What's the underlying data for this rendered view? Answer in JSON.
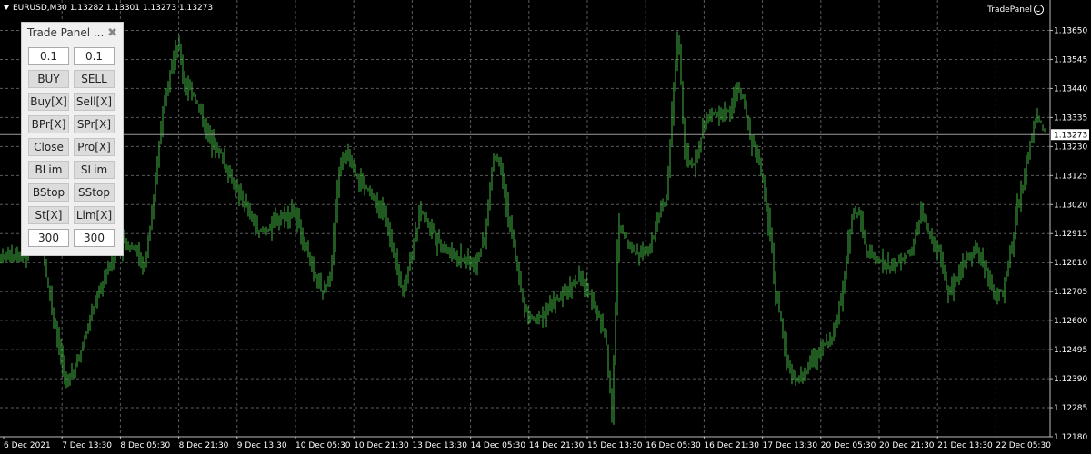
{
  "header": {
    "symbol_line": "EURUSD,M30  1.13282 1.13301 1.13273 1.13273",
    "expert_label": "TradePanel"
  },
  "price_axis": {
    "labels": [
      "1.13650",
      "1.13545",
      "1.13440",
      "1.13335",
      "1.13230",
      "1.13125",
      "1.13020",
      "1.12915",
      "1.12810",
      "1.12705",
      "1.12600",
      "1.12495",
      "1.12390",
      "1.12285",
      "1.12180"
    ],
    "current_price": "1.13273"
  },
  "time_axis": {
    "labels": [
      "6 Dec 2021",
      "7 Dec 13:30",
      "8 Dec 05:30",
      "8 Dec 21:30",
      "9 Dec 13:30",
      "10 Dec 05:30",
      "10 Dec 21:30",
      "13 Dec 13:30",
      "14 Dec 05:30",
      "14 Dec 21:30",
      "15 Dec 13:30",
      "16 Dec 05:30",
      "16 Dec 21:30",
      "17 Dec 13:30",
      "20 Dec 05:30",
      "20 Dec 21:30",
      "21 Dec 13:30",
      "22 Dec 05:30"
    ]
  },
  "colors": {
    "background": "#000000",
    "grid": "#5a5a5a",
    "bars": "#3fb53f",
    "text": "#ffffff"
  },
  "panel": {
    "title": "Trade Panel ...",
    "close_icon": "close-icon",
    "rows": [
      [
        {
          "type": "input",
          "label": "0.1",
          "name": "buy-lot-input"
        },
        {
          "type": "input",
          "label": "0.1",
          "name": "sell-lot-input"
        }
      ],
      [
        {
          "type": "button",
          "label": "BUY",
          "name": "buy-button"
        },
        {
          "type": "button",
          "label": "SELL",
          "name": "sell-button"
        }
      ],
      [
        {
          "type": "button",
          "label": "Buy[X]",
          "name": "close-buy-button"
        },
        {
          "type": "button",
          "label": "Sell[X]",
          "name": "close-sell-button"
        }
      ],
      [
        {
          "type": "button",
          "label": "BPr[X]",
          "name": "close-buy-profit-button"
        },
        {
          "type": "button",
          "label": "SPr[X]",
          "name": "close-sell-profit-button"
        }
      ],
      [
        {
          "type": "button",
          "label": "Close",
          "name": "close-all-button"
        },
        {
          "type": "button",
          "label": "Pro[X]",
          "name": "close-profit-button"
        }
      ],
      [
        {
          "type": "button",
          "label": "BLim",
          "name": "buy-limit-button"
        },
        {
          "type": "button",
          "label": "SLim",
          "name": "sell-limit-button"
        }
      ],
      [
        {
          "type": "button",
          "label": "BStop",
          "name": "buy-stop-button"
        },
        {
          "type": "button",
          "label": "SStop",
          "name": "sell-stop-button"
        }
      ],
      [
        {
          "type": "button",
          "label": "St[X]",
          "name": "delete-stops-button"
        },
        {
          "type": "button",
          "label": "Lim[X]",
          "name": "delete-limits-button"
        }
      ],
      [
        {
          "type": "input",
          "label": "300",
          "name": "buy-distance-input"
        },
        {
          "type": "input",
          "label": "300",
          "name": "sell-distance-input"
        }
      ]
    ]
  },
  "chart_data": {
    "type": "ohlc",
    "symbol": "EURUSD",
    "timeframe": "M30",
    "ylim": [
      1.1218,
      1.1376
    ],
    "last_price": 1.13273,
    "grid": true,
    "price_path": [
      [
        0,
        1.1283
      ],
      [
        30,
        1.1284
      ],
      [
        45,
        1.1292
      ],
      [
        60,
        1.1263
      ],
      [
        75,
        1.1237
      ],
      [
        90,
        1.1248
      ],
      [
        105,
        1.1265
      ],
      [
        120,
        1.1278
      ],
      [
        135,
        1.1288
      ],
      [
        150,
        1.1287
      ],
      [
        160,
        1.1278
      ],
      [
        170,
        1.13
      ],
      [
        180,
        1.1335
      ],
      [
        190,
        1.1352
      ],
      [
        198,
        1.136
      ],
      [
        205,
        1.1345
      ],
      [
        215,
        1.1342
      ],
      [
        230,
        1.1328
      ],
      [
        245,
        1.132
      ],
      [
        260,
        1.1308
      ],
      [
        275,
        1.13
      ],
      [
        285,
        1.1292
      ],
      [
        295,
        1.1293
      ],
      [
        310,
        1.1297
      ],
      [
        325,
        1.13
      ],
      [
        335,
        1.129
      ],
      [
        345,
        1.128
      ],
      [
        355,
        1.127
      ],
      [
        365,
        1.1275
      ],
      [
        375,
        1.1315
      ],
      [
        385,
        1.132
      ],
      [
        395,
        1.1312
      ],
      [
        405,
        1.1308
      ],
      [
        415,
        1.1303
      ],
      [
        425,
        1.1298
      ],
      [
        435,
        1.1285
      ],
      [
        445,
        1.127
      ],
      [
        455,
        1.1285
      ],
      [
        465,
        1.13
      ],
      [
        475,
        1.1295
      ],
      [
        485,
        1.1288
      ],
      [
        495,
        1.1285
      ],
      [
        505,
        1.1283
      ],
      [
        515,
        1.1282
      ],
      [
        525,
        1.128
      ],
      [
        535,
        1.129
      ],
      [
        545,
        1.132
      ],
      [
        552,
        1.1318
      ],
      [
        560,
        1.13
      ],
      [
        568,
        1.1285
      ],
      [
        578,
        1.1265
      ],
      [
        590,
        1.126
      ],
      [
        600,
        1.1263
      ],
      [
        610,
        1.1267
      ],
      [
        620,
        1.1268
      ],
      [
        630,
        1.1273
      ],
      [
        640,
        1.1275
      ],
      [
        650,
        1.127
      ],
      [
        660,
        1.1262
      ],
      [
        668,
        1.1255
      ],
      [
        675,
        1.1225
      ],
      [
        682,
        1.1295
      ],
      [
        690,
        1.129
      ],
      [
        700,
        1.1285
      ],
      [
        710,
        1.1285
      ],
      [
        720,
        1.129
      ],
      [
        728,
        1.13
      ],
      [
        735,
        1.1305
      ],
      [
        742,
        1.134
      ],
      [
        748,
        1.1365
      ],
      [
        755,
        1.132
      ],
      [
        765,
        1.1315
      ],
      [
        775,
        1.133
      ],
      [
        785,
        1.1335
      ],
      [
        795,
        1.1335
      ],
      [
        805,
        1.1335
      ],
      [
        812,
        1.1345
      ],
      [
        820,
        1.134
      ],
      [
        828,
        1.1325
      ],
      [
        835,
        1.132
      ],
      [
        840,
        1.1312
      ],
      [
        845,
        1.13
      ],
      [
        850,
        1.129
      ],
      [
        855,
        1.127
      ],
      [
        860,
        1.1262
      ],
      [
        865,
        1.125
      ],
      [
        872,
        1.124
      ],
      [
        880,
        1.1238
      ],
      [
        890,
        1.1243
      ],
      [
        900,
        1.1248
      ],
      [
        910,
        1.1252
      ],
      [
        920,
        1.1255
      ],
      [
        930,
        1.1275
      ],
      [
        940,
        1.13
      ],
      [
        947,
        1.1298
      ],
      [
        955,
        1.1285
      ],
      [
        965,
        1.1283
      ],
      [
        975,
        1.128
      ],
      [
        985,
        1.128
      ],
      [
        995,
        1.1283
      ],
      [
        1005,
        1.1285
      ],
      [
        1015,
        1.13
      ],
      [
        1025,
        1.129
      ],
      [
        1035,
        1.1285
      ],
      [
        1045,
        1.127
      ],
      [
        1055,
        1.1275
      ],
      [
        1065,
        1.1283
      ],
      [
        1075,
        1.1286
      ],
      [
        1085,
        1.128
      ],
      [
        1095,
        1.127
      ],
      [
        1105,
        1.127
      ],
      [
        1115,
        1.1288
      ],
      [
        1120,
        1.13
      ],
      [
        1128,
        1.131
      ],
      [
        1135,
        1.1325
      ],
      [
        1142,
        1.1335
      ],
      [
        1150,
        1.1328
      ]
    ]
  }
}
